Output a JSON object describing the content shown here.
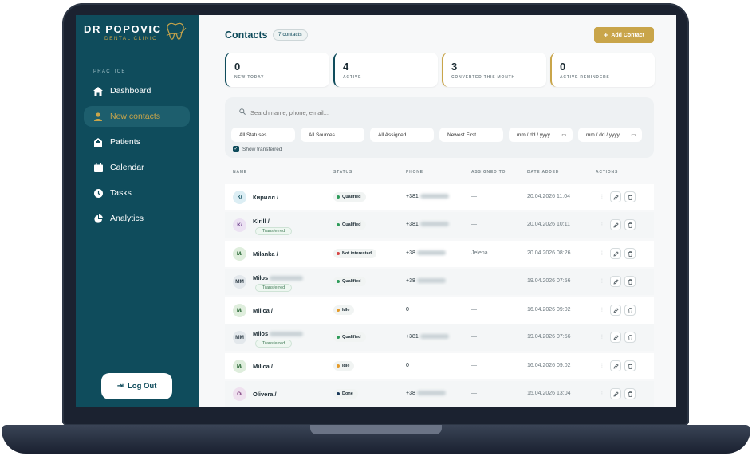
{
  "brand": {
    "title": "DR POPOVIC",
    "subtitle": "DENTAL CLINIC"
  },
  "nav": {
    "section": "PRACTICE",
    "items": [
      {
        "label": "Dashboard",
        "icon": "home-icon"
      },
      {
        "label": "New contacts",
        "icon": "user-icon",
        "active": true
      },
      {
        "label": "Patients",
        "icon": "building-icon"
      },
      {
        "label": "Calendar",
        "icon": "calendar-icon"
      },
      {
        "label": "Tasks",
        "icon": "clock-icon"
      },
      {
        "label": "Analytics",
        "icon": "pie-chart-icon"
      }
    ],
    "logout": "Log Out"
  },
  "header": {
    "title": "Contacts",
    "count": "7 contacts",
    "add_label": "Add Contact"
  },
  "stats": [
    {
      "value": "0",
      "label": "NEW TODAY"
    },
    {
      "value": "4",
      "label": "ACTIVE"
    },
    {
      "value": "3",
      "label": "CONVERTED THIS MONTH"
    },
    {
      "value": "0",
      "label": "ACTIVE REMINDERS"
    }
  ],
  "filters": {
    "search_placeholder": "Search name, phone, email...",
    "statuses": "All Statuses",
    "sources": "All Sources",
    "assigned": "All Assigned",
    "sort": "Newest First",
    "date_from": "mm / dd / yyyy",
    "date_to": "mm / dd / yyyy",
    "show_transferred": "Show transferred"
  },
  "table": {
    "columns": [
      "NAME",
      "STATUS",
      "PHONE",
      "ASSIGNED TO",
      "DATE ADDED",
      "ACTIONS"
    ],
    "rows": [
      {
        "initials": "К/",
        "name": "Кирилл /",
        "tag": "",
        "status": "Qualified",
        "phone": "+381",
        "assigned": "—",
        "date": "20.04.2026 11:04"
      },
      {
        "initials": "K/",
        "name": "Kirill /",
        "tag": "Transferred",
        "status": "Qualified",
        "phone": "+381",
        "assigned": "—",
        "date": "20.04.2026 10:11"
      },
      {
        "initials": "M/",
        "name": "Milanka /",
        "tag": "",
        "status": "Not interested",
        "phone": "+38",
        "assigned": "Jelena",
        "date": "20.04.2026 08:26"
      },
      {
        "initials": "MM",
        "name": "Milos",
        "tag": "Transferred",
        "status": "Qualified",
        "phone": "+38",
        "assigned": "—",
        "date": "19.04.2026 07:56"
      },
      {
        "initials": "M/",
        "name": "Milica /",
        "tag": "",
        "status": "Idle",
        "phone": "0",
        "assigned": "—",
        "date": "16.04.2026 09:02"
      },
      {
        "initials": "MM",
        "name": "Milos",
        "tag": "Transferred",
        "status": "Qualified",
        "phone": "+381",
        "assigned": "—",
        "date": "19.04.2026 07:56"
      },
      {
        "initials": "M/",
        "name": "Milica /",
        "tag": "",
        "status": "Idle",
        "phone": "0",
        "assigned": "—",
        "date": "16.04.2026 09:02"
      },
      {
        "initials": "O/",
        "name": "Olivera /",
        "tag": "",
        "status": "Done",
        "phone": "+38",
        "assigned": "—",
        "date": "15.04.2026 13:04"
      }
    ]
  },
  "colors": {
    "sidebar": "#0f4c5c",
    "accent_gold": "#c9a54a",
    "status_qualified": "#2e9b5a",
    "status_not_interested": "#d64545",
    "status_idle": "#e49a2a",
    "status_done": "#1b3a5c"
  }
}
